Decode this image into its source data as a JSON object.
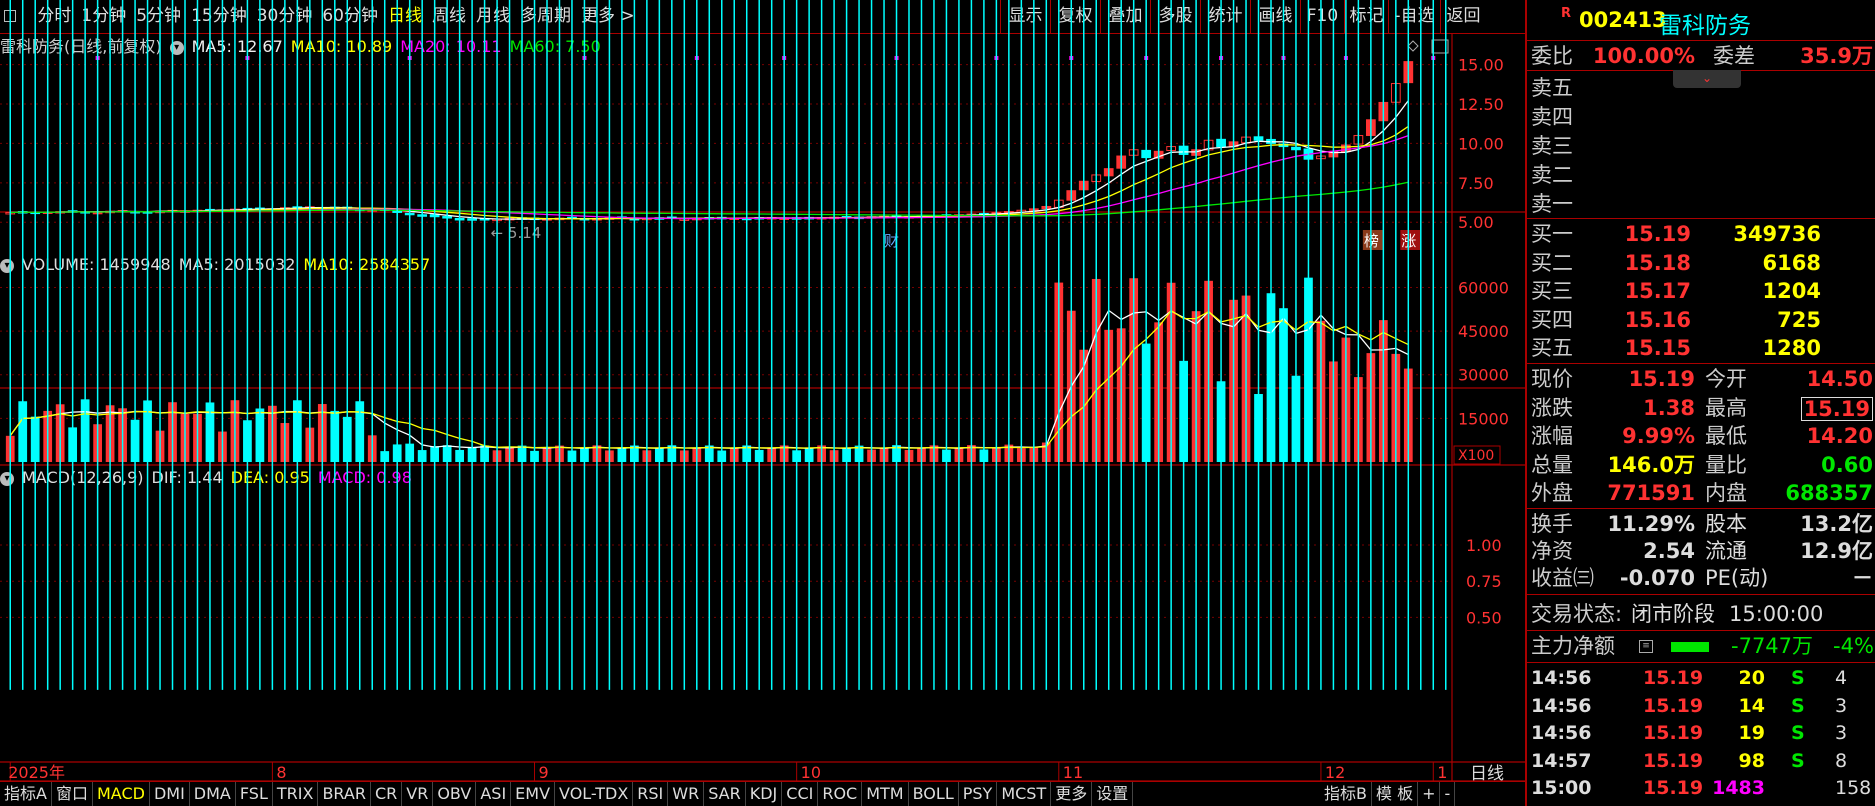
{
  "toolbar": {
    "periods": [
      "分时",
      "1分钟",
      "5分钟",
      "15分钟",
      "30分钟",
      "60分钟",
      "日线",
      "周线",
      "月线",
      "多周期",
      "更多 >"
    ],
    "selected_index": 6,
    "right_buttons": [
      "显示",
      "复权",
      "叠加",
      "多股",
      "统计",
      "画线",
      "F10",
      "标记",
      "-自选",
      "返回"
    ]
  },
  "stock": {
    "code": "002413",
    "name": "雷科防务",
    "market_flag": "R"
  },
  "price_legend": {
    "title": "雷科防务(日线,前复权)",
    "ma5": "MA5: 12.67",
    "ma10": "MA10: 10.89",
    "ma20": "MA20: 10.11",
    "ma60": "MA60: 7.50"
  },
  "volume_legend": {
    "title": "VOLUME: 1459948",
    "ma5": "MA5: 2015032",
    "ma10": "MA10: 2584357"
  },
  "macd_legend": {
    "title": "MACD(12,26,9)",
    "dif": "DIF: 1.44",
    "dea": "DEA: 0.95",
    "macd": "MACD: 0.98"
  },
  "price_axis": [
    "15.00",
    "12.50",
    "10.00",
    "7.50",
    "5.00"
  ],
  "volume_axis": [
    "60000",
    "45000",
    "30000",
    "15000"
  ],
  "volume_unit": "X100",
  "macd_axis": [
    "1.00",
    "0.75",
    "0.50"
  ],
  "annotations": {
    "high": "15.19",
    "low": "5.14",
    "cai": "财",
    "bang": "榜",
    "zhang": "涨"
  },
  "date_axis": [
    "2025年",
    "8",
    "9",
    "10",
    "11",
    "12",
    "1"
  ],
  "period_label": "日线",
  "bottom_tabs": [
    "指标A",
    "窗口",
    "MACD",
    "DMI",
    "DMA",
    "FSL",
    "TRIX",
    "BRAR",
    "CR",
    "VR",
    "OBV",
    "ASI",
    "EMV",
    "VOL-TDX",
    "RSI",
    "WR",
    "SAR",
    "KDJ",
    "CCI",
    "ROC",
    "MTM",
    "BOLL",
    "PSY",
    "MCST",
    "更多",
    "设置"
  ],
  "bottom_selected": "MACD",
  "bottom_right": [
    "指标B",
    "模 板",
    "+",
    "-"
  ],
  "quote": {
    "weibi_label": "委比",
    "weibi": "100.00%",
    "weicha_label": "委差",
    "weicha": "35.9万",
    "asks": [
      {
        "label": "卖五"
      },
      {
        "label": "卖四"
      },
      {
        "label": "卖三"
      },
      {
        "label": "卖二"
      },
      {
        "label": "卖一"
      }
    ],
    "bids": [
      {
        "label": "买一",
        "price": "15.19",
        "vol": "349736"
      },
      {
        "label": "买二",
        "price": "15.18",
        "vol": "6168"
      },
      {
        "label": "买三",
        "price": "15.17",
        "vol": "1204"
      },
      {
        "label": "买四",
        "price": "15.16",
        "vol": "725"
      },
      {
        "label": "买五",
        "price": "15.15",
        "vol": "1280"
      }
    ],
    "stats": [
      {
        "l1": "现价",
        "v1": "15.19",
        "c1": "red",
        "l2": "今开",
        "v2": "14.50",
        "c2": "red"
      },
      {
        "l1": "涨跌",
        "v1": "1.38",
        "c1": "red",
        "l2": "最高",
        "v2": "15.19",
        "c2": "red"
      },
      {
        "l1": "涨幅",
        "v1": "9.99%",
        "c1": "red",
        "l2": "最低",
        "v2": "14.20",
        "c2": "red"
      },
      {
        "l1": "总量",
        "v1": "146.0万",
        "c1": "yel",
        "l2": "量比",
        "v2": "0.60",
        "c2": "grn"
      },
      {
        "l1": "外盘",
        "v1": "771591",
        "c1": "red",
        "l2": "内盘",
        "v2": "688357",
        "c2": "grn"
      }
    ],
    "stats2": [
      {
        "l1": "换手",
        "v1": "11.29%",
        "l2": "股本",
        "v2": "13.2亿"
      },
      {
        "l1": "净资",
        "v1": "2.54",
        "l2": "流通",
        "v2": "12.9亿"
      },
      {
        "l1": "收益㈢",
        "v1": "-0.070",
        "l2": "PE(动)",
        "v2": "－"
      }
    ],
    "status_label": "交易状态:",
    "status_value": "闭市阶段",
    "status_time": "15:00:00",
    "main_net_label": "主力净额",
    "main_net_value": "-7747万",
    "main_net_pct": "-4%",
    "ticks": [
      {
        "time": "14:56",
        "price": "15.19",
        "vol": "20",
        "side": "S",
        "n": "4"
      },
      {
        "time": "14:56",
        "price": "15.19",
        "vol": "14",
        "side": "S",
        "n": "3"
      },
      {
        "time": "14:56",
        "price": "15.19",
        "vol": "19",
        "side": "S",
        "n": "3"
      },
      {
        "time": "14:57",
        "price": "15.19",
        "vol": "98",
        "side": "S",
        "n": "8"
      },
      {
        "time": "15:00",
        "price": "15.19",
        "vol": "1483",
        "side": "",
        "n": "158"
      }
    ]
  },
  "chart_data": {
    "type": "candlestick",
    "count": 116,
    "price_ylim": [
      4.0,
      15.8
    ],
    "volume_ylim": [
      0,
      66000
    ],
    "macd_ylim": [
      -0.45,
      1.38
    ],
    "closes": [
      5.62,
      5.66,
      5.61,
      5.65,
      5.68,
      5.72,
      5.65,
      5.63,
      5.7,
      5.74,
      5.68,
      5.64,
      5.7,
      5.75,
      5.72,
      5.76,
      5.8,
      5.78,
      5.83,
      5.87,
      5.9,
      5.85,
      5.92,
      5.95,
      5.98,
      5.94,
      5.9,
      5.86,
      5.82,
      5.8,
      5.76,
      5.62,
      5.5,
      5.42,
      5.35,
      5.3,
      5.22,
      5.18,
      5.14,
      5.2,
      5.25,
      5.22,
      5.19,
      5.23,
      5.26,
      5.22,
      5.2,
      5.24,
      5.28,
      5.25,
      5.22,
      5.26,
      5.28,
      5.24,
      5.21,
      5.25,
      5.28,
      5.3,
      5.27,
      5.24,
      5.28,
      5.3,
      5.27,
      5.25,
      5.27,
      5.3,
      5.32,
      5.29,
      5.31,
      5.35,
      5.38,
      5.34,
      5.36,
      5.39,
      5.42,
      5.45,
      5.48,
      5.52,
      5.55,
      5.62,
      5.68,
      5.76,
      5.85,
      6.0,
      6.4,
      7.0,
      7.6,
      8.0,
      8.4,
      9.2,
      9.6,
      9.1,
      9.5,
      9.8,
      9.3,
      9.6,
      10.2,
      9.8,
      10.1,
      10.4,
      10.2,
      10.0,
      9.8,
      9.6,
      9.0,
      9.2,
      9.5,
      9.9,
      10.5,
      11.5,
      12.6,
      13.8,
      15.19
    ]
  }
}
